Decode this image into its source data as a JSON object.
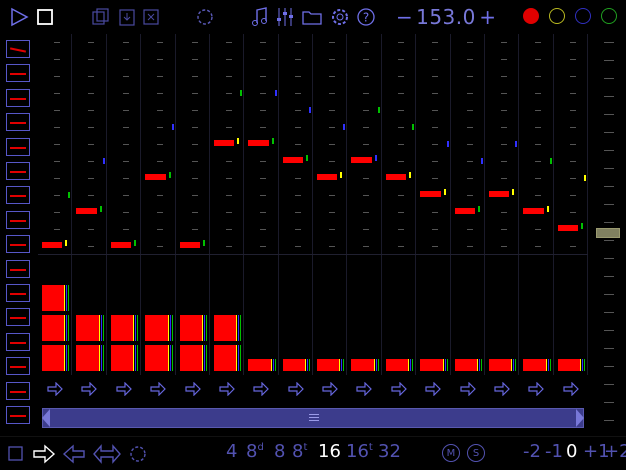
{
  "toolbar": {
    "play_icon": "play-icon",
    "stop_icon": "stop-icon",
    "bpm_minus": "−",
    "bpm_value": "153.0",
    "bpm_plus": "+",
    "colors": {
      "red": "#e00000",
      "yellow": "#b8b820",
      "blue": "#3030c0",
      "green": "#20a020"
    }
  },
  "tracks": [
    {
      "note": 0,
      "marks": [
        "#ffff00",
        "#00c000"
      ]
    },
    {
      "note": 2,
      "marks": [
        "#00c000",
        "#3030ff"
      ]
    },
    {
      "note": 0,
      "marks": [
        "#00c000"
      ]
    },
    {
      "note": 4,
      "marks": [
        "#00c000",
        "#3030ff"
      ]
    },
    {
      "note": 0,
      "marks": [
        "#00c000"
      ]
    },
    {
      "note": 6,
      "marks": [
        "#ffff00",
        "#00c000"
      ]
    },
    {
      "note": 6,
      "marks": [
        "#00c000",
        "#3030ff"
      ]
    },
    {
      "note": 5,
      "marks": [
        "#00c000",
        "#3030ff"
      ]
    },
    {
      "note": 4,
      "marks": [
        "#ffff00",
        "#3030ff"
      ]
    },
    {
      "note": 5,
      "marks": [
        "#3030ff",
        "#00c000"
      ]
    },
    {
      "note": 4,
      "marks": [
        "#ffff00",
        "#00c000"
      ]
    },
    {
      "note": 3,
      "marks": [
        "#ffff00",
        "#3030ff"
      ]
    },
    {
      "note": 2,
      "marks": [
        "#00c000",
        "#3030ff"
      ]
    },
    {
      "note": 3,
      "marks": [
        "#ffff00",
        "#3030ff"
      ]
    },
    {
      "note": 2,
      "marks": [
        "#ffff00",
        "#00c000"
      ]
    },
    {
      "note": 1,
      "marks": [
        "#00c000",
        "#ffff00"
      ]
    }
  ],
  "velocity_levels": [
    2,
    1,
    1,
    1,
    1,
    1,
    0,
    0,
    0,
    0,
    0,
    0,
    0,
    0,
    0,
    0
  ],
  "bottom": {
    "d4": "4",
    "d8d": "8",
    "d8d_sup": "d",
    "d8": "8",
    "d8t": "8",
    "d8t_sup": "t",
    "d16": "16",
    "d16t": "16",
    "d16t_sup": "t",
    "d32": "32",
    "m_label": "M",
    "s_label": "S",
    "oct_m2": "-2",
    "oct_m1": "-1",
    "oct_0": "0",
    "oct_p1": "+1",
    "oct_p2": "+2"
  }
}
